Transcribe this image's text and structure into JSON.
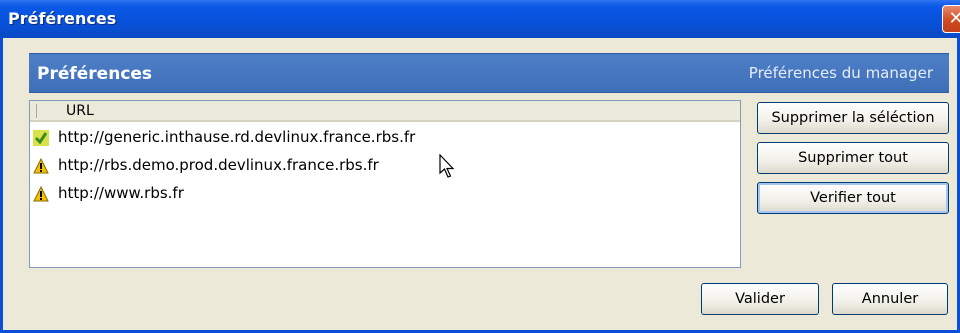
{
  "window": {
    "title": "Préférences",
    "close_glyph": "✕"
  },
  "header": {
    "title": "Préférences",
    "subtitle": "Préférences du manager"
  },
  "list": {
    "column_header": "URL",
    "rows": [
      {
        "url": "http://generic.inthause.rd.devlinux.france.rbs.fr",
        "icon": "ok-status-icon"
      },
      {
        "url": "http://rbs.demo.prod.devlinux.france.rbs.fr",
        "icon": "warning-icon"
      },
      {
        "url": "http://www.rbs.fr",
        "icon": "warning-icon"
      }
    ]
  },
  "buttons": {
    "delete_selection": "Supprimer la séléction",
    "delete_all": "Supprimer tout",
    "verify_all": "Verifier tout",
    "validate": "Valider",
    "cancel": "Annuler"
  },
  "colors": {
    "titlebar": "#0a58e8",
    "header_band": "#4777c0",
    "dialog_bg": "#ece9d8",
    "close": "#d04a22"
  }
}
